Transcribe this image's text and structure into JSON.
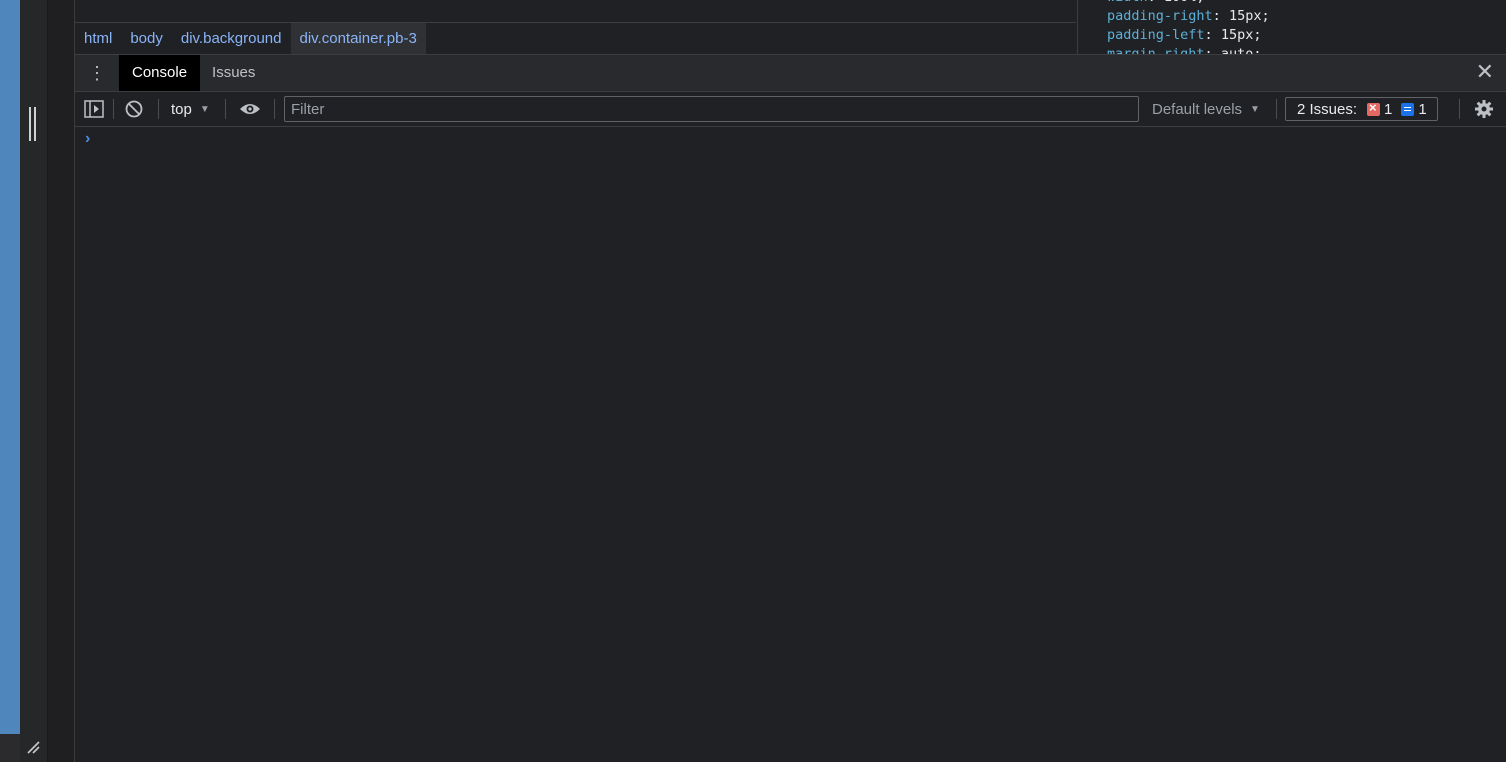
{
  "breadcrumb": [
    "html",
    "body",
    "div.background",
    "div.container.pb-3"
  ],
  "styles": [
    {
      "prop": "padding-right",
      "value": "15px"
    },
    {
      "prop": "padding-left",
      "value": "15px"
    },
    {
      "prop": "margin-right",
      "value": "auto"
    }
  ],
  "tabs": {
    "console": "Console",
    "issues": "Issues"
  },
  "toolbar": {
    "context": "top",
    "filter_placeholder": "Filter",
    "levels": "Default levels",
    "issues_label": "2 Issues:",
    "error_count": "1",
    "info_count": "1"
  },
  "colors": {
    "accent": "#8ab4f8",
    "error": "#e46962",
    "info": "#1a73e8",
    "left_strip": "#4f87bd"
  }
}
